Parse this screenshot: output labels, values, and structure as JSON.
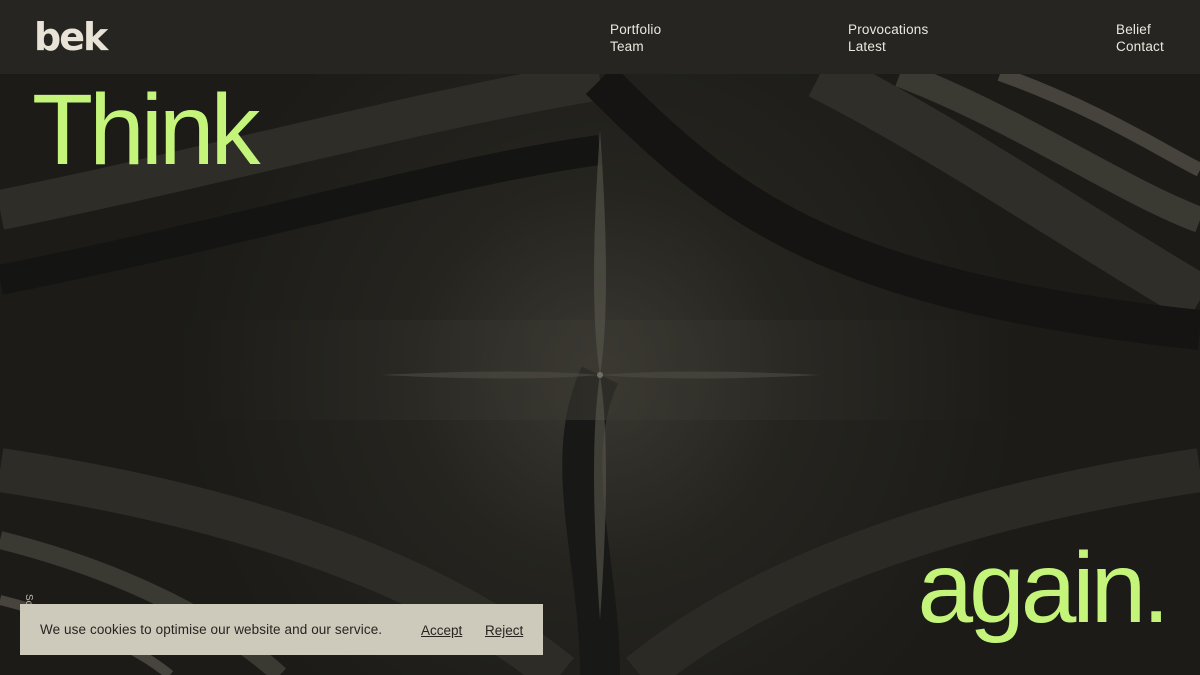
{
  "brand": {
    "logo_text": "bek"
  },
  "nav": {
    "col1": [
      "Portfolio",
      "Team"
    ],
    "col2": [
      "Provocations",
      "Latest"
    ],
    "col3": [
      "Belief",
      "Contact"
    ]
  },
  "hero": {
    "word1": "Think",
    "word2": "again."
  },
  "scroll_hint": "Scroll",
  "cookie": {
    "message": "We use cookies to optimise our website and our service.",
    "accept_label": "Accept",
    "reject_label": "Reject"
  },
  "colors": {
    "accent": "#c4f57a",
    "background": "#1f1e1b",
    "header": "#262521",
    "cookie_bg": "#cdc9bb"
  }
}
